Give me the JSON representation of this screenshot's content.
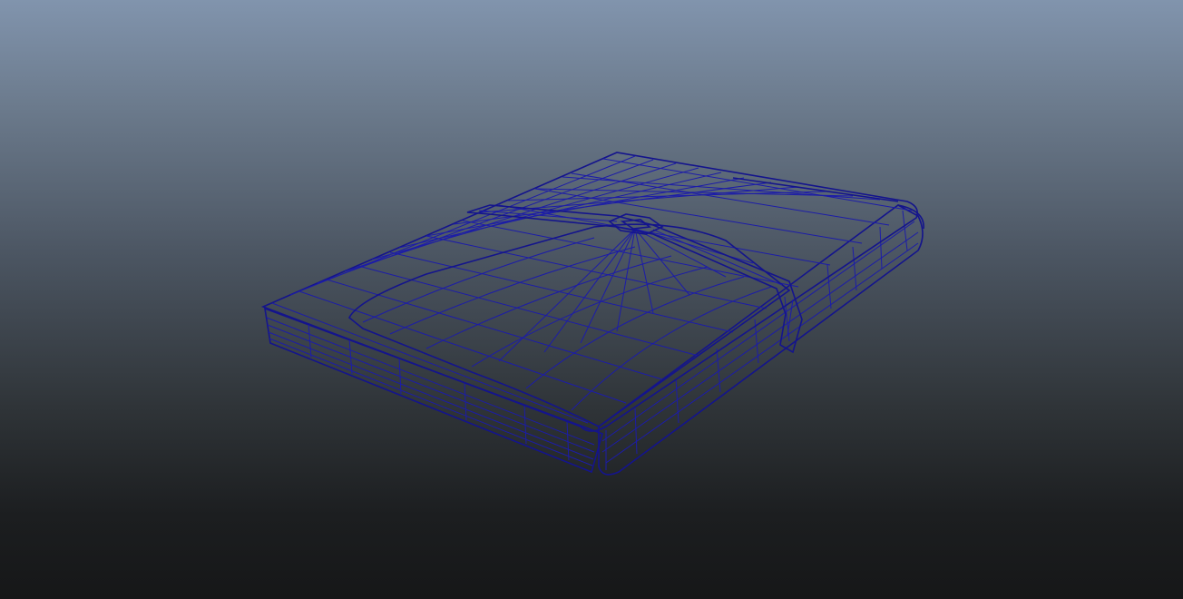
{
  "viewport": {
    "background_top": "#8194ad",
    "background_bottom": "#161718"
  },
  "model": {
    "shading": "smooth-shade-with-wireframe",
    "surface_color": "#474747",
    "wire_color": "#1c1ca8"
  }
}
